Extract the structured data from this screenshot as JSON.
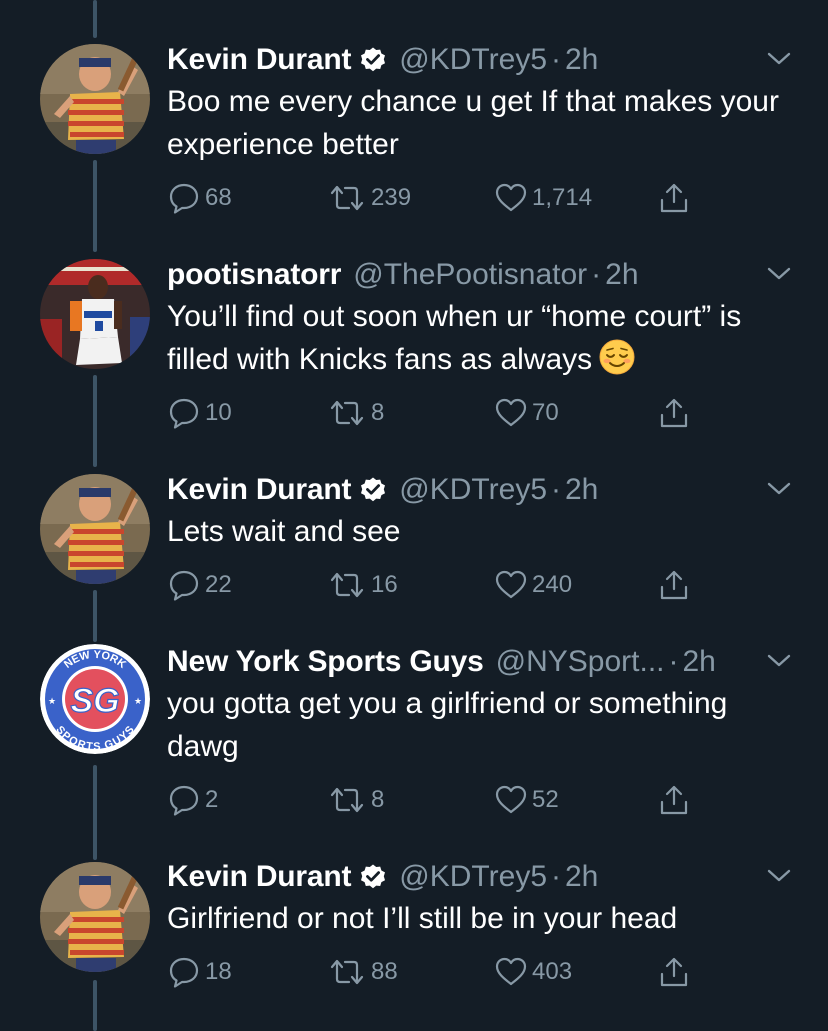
{
  "tweets": [
    {
      "name": "Kevin Durant",
      "verified": true,
      "handle": "@KDTrey5",
      "separator": "·",
      "time": "2h",
      "text": "Boo me every chance u get If that makes your experience better",
      "emoji": "",
      "replies": "68",
      "retweets": "239",
      "likes": "1,714",
      "avatar": "baseball-player-avatar"
    },
    {
      "name": "pootisnatorr",
      "verified": false,
      "handle": "@ThePootisnator",
      "separator": "·",
      "time": "2h",
      "text": "You’ll find out soon when ur “home court” is filled with Knicks fans as always",
      "emoji": "relieved-face",
      "replies": "10",
      "retweets": "8",
      "likes": "70",
      "avatar": "knicks-player-avatar"
    },
    {
      "name": "Kevin Durant",
      "verified": true,
      "handle": "@KDTrey5",
      "separator": "·",
      "time": "2h",
      "text": "Lets wait and see",
      "emoji": "",
      "replies": "22",
      "retweets": "16",
      "likes": "240",
      "avatar": "baseball-player-avatar"
    },
    {
      "name": "New York Sports Guys",
      "verified": false,
      "handle": "@NYSport...",
      "separator": "·",
      "time": "2h",
      "text": "you gotta get you a girlfriend or something dawg",
      "emoji": "",
      "replies": "2",
      "retweets": "8",
      "likes": "52",
      "avatar": "ny-sports-guys-logo"
    },
    {
      "name": "Kevin Durant",
      "verified": true,
      "handle": "@KDTrey5",
      "separator": "·",
      "time": "2h",
      "text": "Girlfriend or not I’ll still be in your head",
      "emoji": "",
      "replies": "18",
      "retweets": "88",
      "likes": "403",
      "avatar": "baseball-player-avatar"
    }
  ],
  "colors": {
    "background": "#141d26",
    "muted": "#8899a6",
    "thread_line": "#3d5466",
    "text": "#ffffff"
  },
  "logo_text": {
    "ring_top": "NEW YORK",
    "ring_bottom": "SPORTS GUYS",
    "monogram": "SG"
  }
}
